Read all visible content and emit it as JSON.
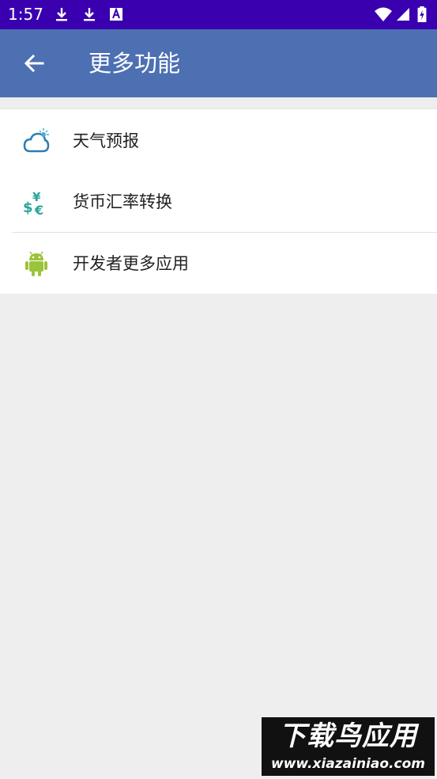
{
  "status_bar": {
    "time": "1:57",
    "icons": [
      "download-icon",
      "download-icon",
      "text-app-icon",
      "wifi-icon",
      "cellular-signal-icon",
      "battery-charging-icon"
    ]
  },
  "app_bar": {
    "back_icon": "arrow-left-icon",
    "title": "更多功能",
    "background": "#4D70B3"
  },
  "menu": {
    "items": [
      {
        "label": "天气预报",
        "icon": "weather-cloud-sun-icon",
        "icon_color": "#2C7FAF"
      },
      {
        "label": "货币汇率转换",
        "icon": "currency-exchange-icon",
        "icon_color": "#2AA39A"
      },
      {
        "label": "开发者更多应用",
        "icon": "android-icon",
        "icon_color": "#9BC43A"
      }
    ]
  },
  "watermark": {
    "title": "下载鸟应用",
    "url": "www.xiazainiao.com"
  }
}
